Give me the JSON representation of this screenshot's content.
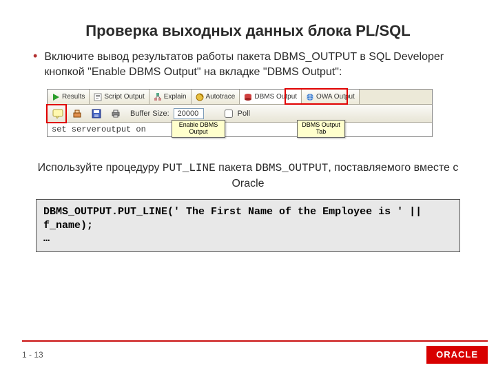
{
  "title": "Проверка выходных данных блока PL/SQL",
  "bullet1": "Включите вывод результатов работы пакета DBMS_OUTPUT в SQL Developer кнопкой \"Enable DBMS Output\" на вкладке \"DBMS Output\":",
  "tabs": {
    "results": "Results",
    "script": "Script Output",
    "explain": "Explain",
    "autotrace": "Autotrace",
    "dbms": "DBMS Output",
    "owa": "OWA Output"
  },
  "toolbar": {
    "buffer_label": "Buffer Size:",
    "buffer_value": "20000",
    "poll_label": "Poll"
  },
  "cmdline": "set serveroutput on",
  "callout_enable": "Enable DBMS Output",
  "callout_dbmstab": "DBMS Output Tab",
  "para2_a": "Используйте процедуру ",
  "para2_b": "PUT_LINE",
  "para2_c": " пакета ",
  "para2_d": "DBMS_OUTPUT",
  "para2_e": ", поставляемого вместе с Oracle",
  "code": "DBMS_OUTPUT.PUT_LINE(' The First Name of the Employee is ' || f_name);\n…",
  "footer": {
    "page": "1 - 13",
    "brand": "ORACLE"
  }
}
